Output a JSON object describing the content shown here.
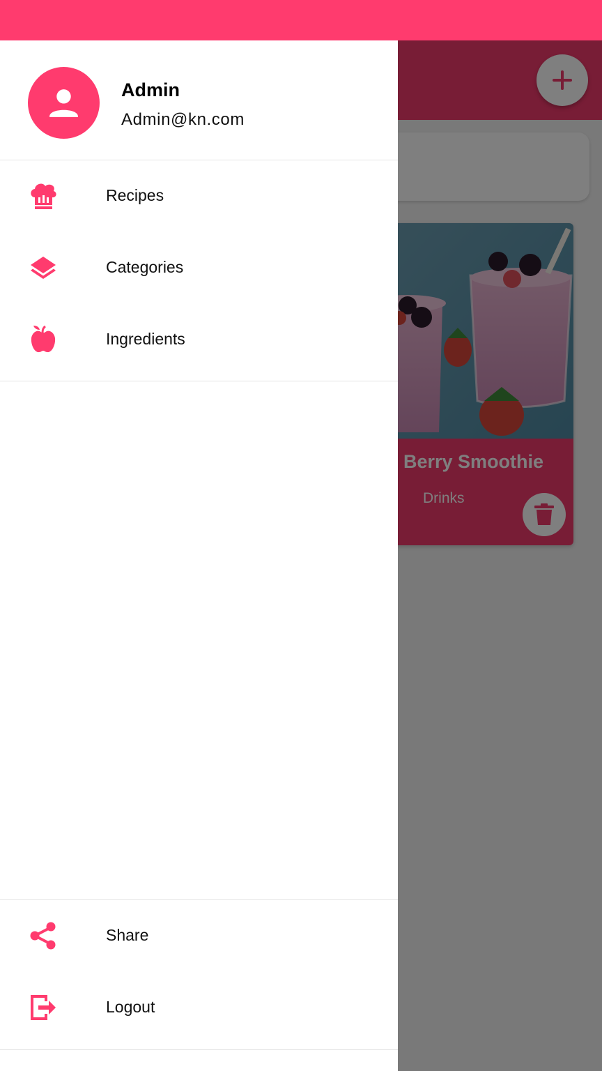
{
  "colors": {
    "accent": "#FF3B6E",
    "app_bar": "#F03A6C"
  },
  "background_app": {
    "add_icon": "plus-icon",
    "recipe": {
      "title": "Berry Smoothie",
      "category": "Drinks",
      "delete_icon": "trash-icon"
    }
  },
  "drawer": {
    "user": {
      "name": "Admin",
      "email": "Admin@kn.com",
      "avatar_icon": "person-icon"
    },
    "primary_items": [
      {
        "label": "Recipes",
        "icon": "chef-hat-icon"
      },
      {
        "label": "Categories",
        "icon": "layers-icon"
      },
      {
        "label": "Ingredients",
        "icon": "apple-icon"
      }
    ],
    "secondary_items": [
      {
        "label": "Share",
        "icon": "share-icon"
      },
      {
        "label": "Logout",
        "icon": "logout-icon"
      }
    ]
  }
}
